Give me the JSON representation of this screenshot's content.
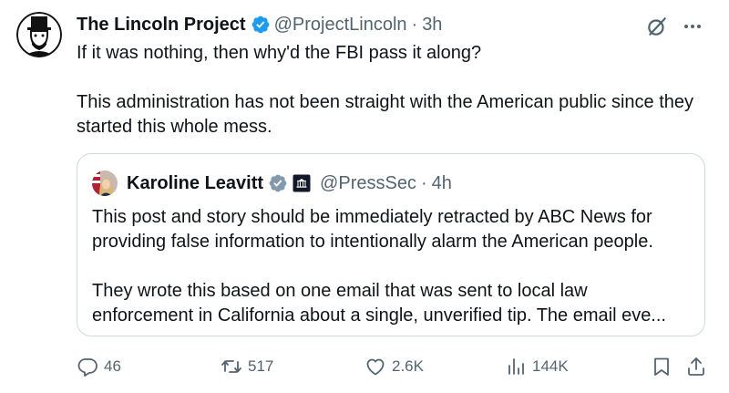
{
  "author": {
    "name": "The Lincoln Project",
    "handle": "@ProjectLincoln",
    "separator": "·",
    "time": "3h",
    "avatar_icon": "lincoln-portrait-icon",
    "verified_color": "#1d9bf0"
  },
  "tweet": {
    "paragraphs": [
      "If it was nothing, then why'd the FBI pass it along?",
      "This administration has not been straight with the American public since they started this whole mess."
    ]
  },
  "quoted": {
    "name": "Karoline Leavitt",
    "handle": "@PressSec",
    "separator": "·",
    "time": "4h",
    "verified_color": "#829aab",
    "affiliate_icon": "white-house-badge-icon",
    "paragraphs": [
      "This post and story should be immediately retracted by ABC News for providing false information to intentionally alarm the American people.",
      "They wrote this based on one email that was sent to local law enforcement in California about a single, unverified tip. The email eve..."
    ]
  },
  "actions": {
    "replies": "46",
    "reposts": "517",
    "likes": "2.6K",
    "views": "144K"
  },
  "colors": {
    "text": "#0f1419",
    "muted": "#536471",
    "border": "#cfd9de"
  }
}
